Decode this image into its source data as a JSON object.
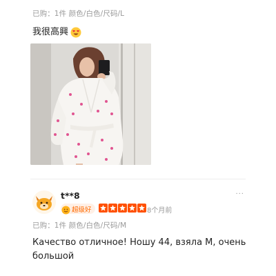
{
  "review_top": {
    "purchase_info": "已购：1件  颜色/白色/尺码/L",
    "text": "我很高興",
    "emoji_icon": "heart-eyes-emoji-icon"
  },
  "reviewer": {
    "name": "t**8",
    "badge": "超级好",
    "rating": 5,
    "rating_max": 5,
    "time": "8个月前",
    "more": "···"
  },
  "review_bottom": {
    "purchase_info": "已购：1件  颜色/白色/尺码/M",
    "text": "Качество отличное! Ношу 44, взяла M, очень большой"
  },
  "colors": {
    "star": "#ff5000",
    "badge_text": "#ff6a00",
    "muted_text": "#9a9a9a"
  }
}
